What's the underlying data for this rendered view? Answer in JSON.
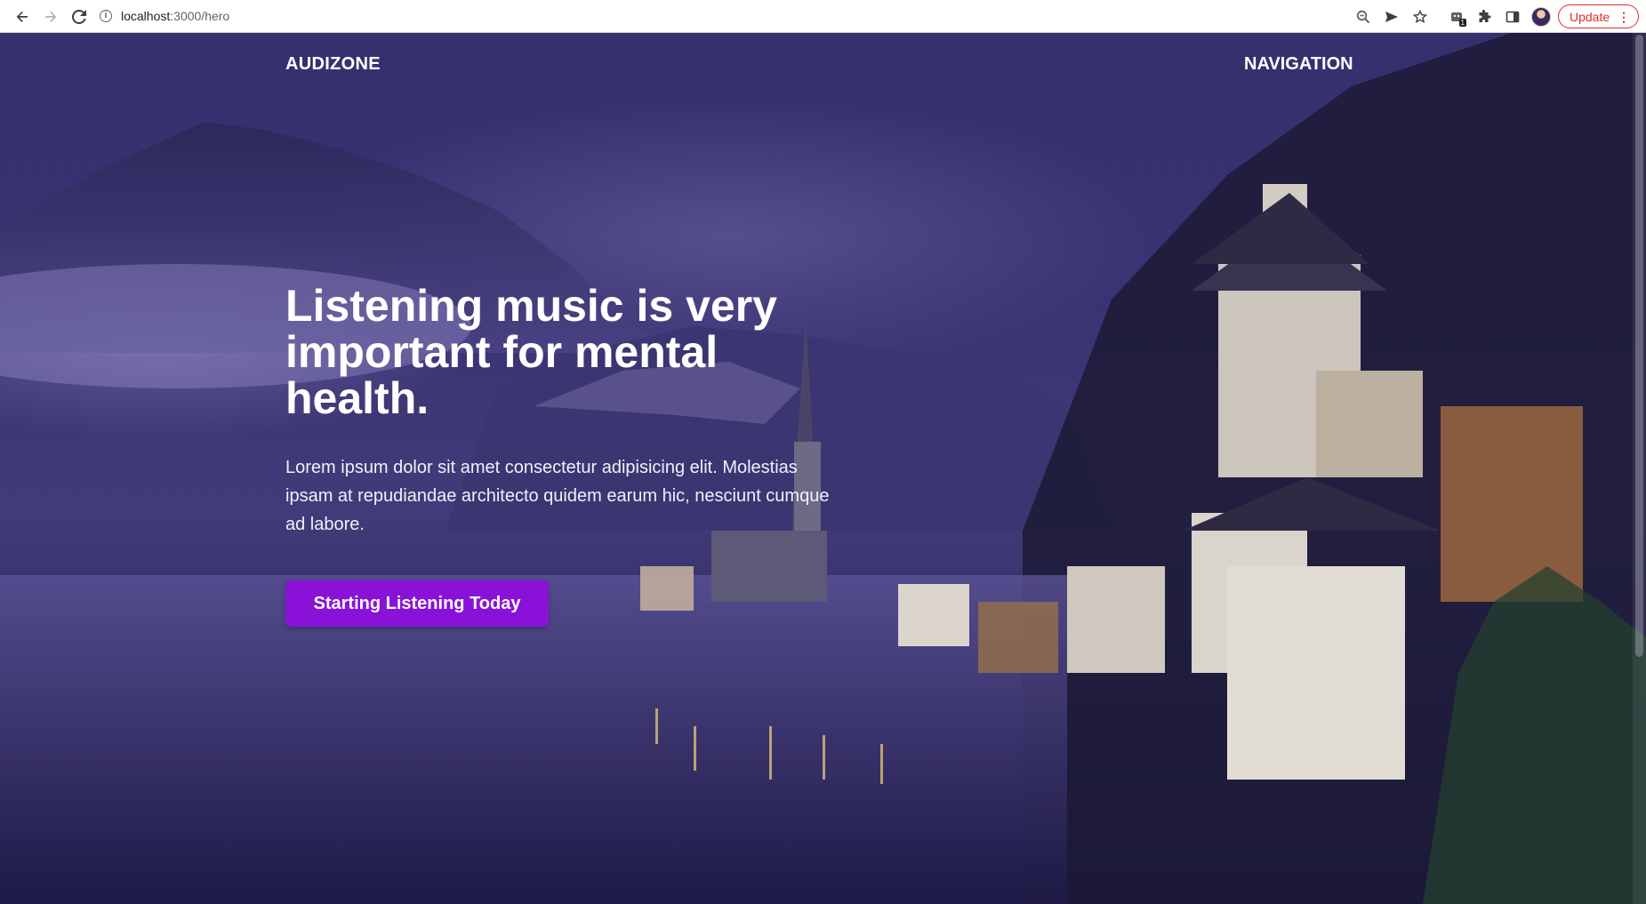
{
  "browser": {
    "url_host": "localhost",
    "url_path": ":3000/hero",
    "update_label": "Update",
    "extension_badge": "1"
  },
  "header": {
    "brand": "AUDIZONE",
    "nav_label": "NAVIGATION"
  },
  "hero": {
    "title": "Listening music is very important for mental health.",
    "text": "Lorem ipsum dolor sit amet consectetur adipisicing elit. Molestias ipsam at repudiandae architecto quidem earum hic, nesciunt cumque ad labore.",
    "cta_label": "Starting Listening Today"
  },
  "colors": {
    "cta": "#8a12d8",
    "overlay": "#3c3578",
    "update": "#d93025"
  }
}
